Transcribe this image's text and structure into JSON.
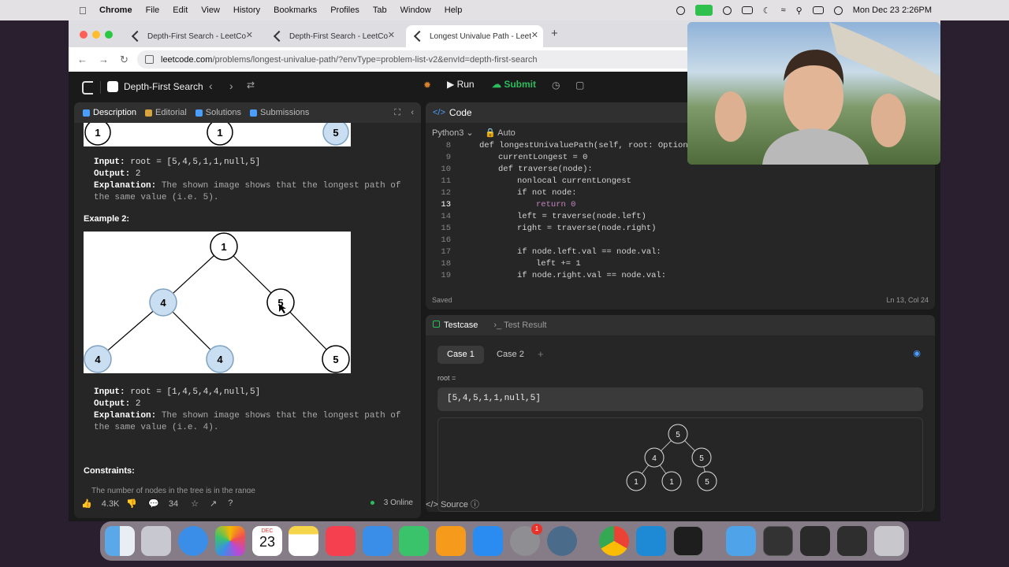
{
  "menubar": {
    "app": "Chrome",
    "items": [
      "File",
      "Edit",
      "View",
      "History",
      "Bookmarks",
      "Profiles",
      "Tab",
      "Window",
      "Help"
    ],
    "datetime": "Mon Dec 23  2:26PM"
  },
  "browser": {
    "tabs": [
      {
        "title": "Depth-First Search - LeetCo"
      },
      {
        "title": "Depth-First Search - LeetCo"
      },
      {
        "title": "Longest Univalue Path - Leet"
      }
    ],
    "url_host": "leetcode.com",
    "url_path": "/problems/longest-univalue-path/?envType=problem-list-v2&envId=depth-first-search"
  },
  "leetcode": {
    "list_title": "Depth-First Search",
    "run_label": "Run",
    "submit_label": "Submit"
  },
  "description": {
    "tabs": [
      "Description",
      "Editorial",
      "Solutions",
      "Submissions"
    ],
    "example1": {
      "input_label": "Input:",
      "input": "root = [5,4,5,1,1,null,5]",
      "output_label": "Output:",
      "output": "2",
      "explanation_label": "Explanation:",
      "explanation": "The shown image shows that the longest path of the same value (i.e. 5)."
    },
    "example2_heading": "Example 2:",
    "example2": {
      "input_label": "Input:",
      "input": "root = [1,4,5,4,4,null,5]",
      "output_label": "Output:",
      "output": "2",
      "explanation_label": "Explanation:",
      "explanation": "The shown image shows that the longest path of the same value (i.e. 4)."
    },
    "constraints_heading": "Constraints:",
    "constraints_partial": "The number of nodes in the tree is in the range",
    "tree1_nodes": [
      "1",
      "1",
      "5"
    ],
    "tree2_nodes": [
      "1",
      "4",
      "5",
      "4",
      "4",
      "5"
    ],
    "footer": {
      "likes": "4.3K",
      "comments": "34",
      "online": "3 Online"
    }
  },
  "code": {
    "header": "Code",
    "language": "Python3",
    "mode": "Auto",
    "lines": [
      {
        "n": "8",
        "text": "def longestUnivaluePath(self, root: Optional"
      },
      {
        "n": "9",
        "text": "currentLongest = 0"
      },
      {
        "n": "10",
        "text": "def traverse(node):"
      },
      {
        "n": "11",
        "text": "nonlocal currentLongest"
      },
      {
        "n": "12",
        "text": "if not node:"
      },
      {
        "n": "13",
        "text": "return 0"
      },
      {
        "n": "14",
        "text": "left = traverse(node.left)"
      },
      {
        "n": "15",
        "text": "right = traverse(node.right)"
      },
      {
        "n": "16",
        "text": ""
      },
      {
        "n": "17",
        "text": "if node.left.val == node.val:"
      },
      {
        "n": "18",
        "text": "left += 1"
      },
      {
        "n": "19",
        "text": "if node.right.val == node.val:"
      }
    ],
    "status": "Saved",
    "cursor_pos": "Ln 13, Col 24"
  },
  "testcase": {
    "tab_testcase": "Testcase",
    "tab_result": "Test Result",
    "cases": [
      "Case 1",
      "Case 2"
    ],
    "root_label": "root =",
    "root_value": "[5,4,5,1,1,null,5]",
    "tree_nodes": [
      "5",
      "4",
      "5",
      "1",
      "1",
      "5"
    ],
    "source_label": "Source"
  },
  "dock": {
    "calendar_month": "DEC",
    "calendar_day": "23",
    "settings_badge": "1"
  }
}
